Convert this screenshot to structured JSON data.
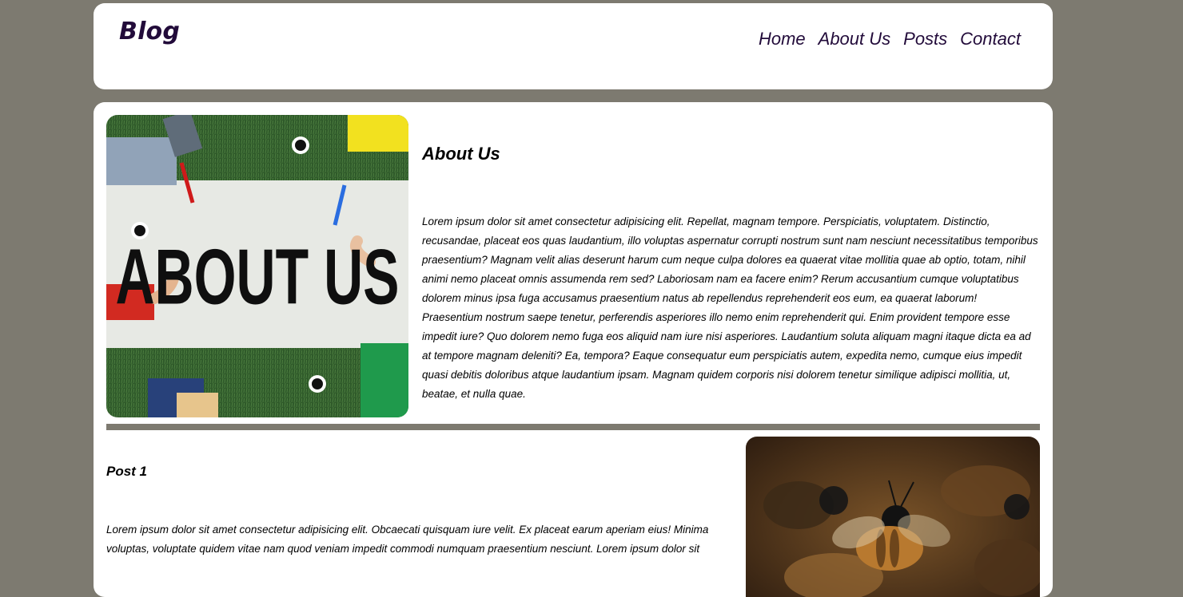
{
  "site": {
    "logo": "Blog"
  },
  "nav": {
    "items": [
      {
        "label": "Home"
      },
      {
        "label": "About Us"
      },
      {
        "label": "Posts"
      },
      {
        "label": "Contact"
      }
    ]
  },
  "about": {
    "image_text": "ABOUT US",
    "title": "About Us",
    "text": "Lorem ipsum dolor sit amet consectetur adipisicing elit. Repellat, magnam tempore. Perspiciatis, voluptatem. Distinctio, recusandae, placeat eos quas laudantium, illo voluptas aspernatur corrupti nostrum sunt nam nesciunt necessitatibus temporibus praesentium? Magnam velit alias deserunt harum cum neque culpa dolores ea quaerat vitae mollitia quae ab optio, totam, nihil animi nemo placeat omnis assumenda rem sed? Laboriosam nam ea facere enim? Rerum accusantium cumque voluptatibus dolorem minus ipsa fuga accusamus praesentium natus ab repellendus reprehenderit eos eum, ea quaerat laborum! Praesentium nostrum saepe tenetur, perferendis asperiores illo nemo enim reprehenderit qui. Enim provident tempore esse impedit iure? Quo dolorem nemo fuga eos aliquid nam iure nisi asperiores. Laudantium soluta aliquam magni itaque dicta ea ad at tempore magnam deleniti? Ea, tempora? Eaque consequatur eum perspiciatis autem, expedita nemo, cumque eius impedit quasi debitis doloribus atque laudantium ipsam. Magnam quidem corporis nisi dolorem tenetur similique adipisci mollitia, ut, beatae, et nulla quae."
  },
  "post1": {
    "title": "Post 1",
    "text": "Lorem ipsum dolor sit amet consectetur adipisicing elit. Obcaecati quisquam iure velit. Ex placeat earum aperiam eius! Minima voluptas, voluptate quidem vitae nam quod veniam impedit commodi numquam praesentium nesciunt. Lorem ipsum dolor sit"
  },
  "colors": {
    "background": "#7d7a70",
    "accent": "#220b3a",
    "panel": "#ffffff"
  }
}
